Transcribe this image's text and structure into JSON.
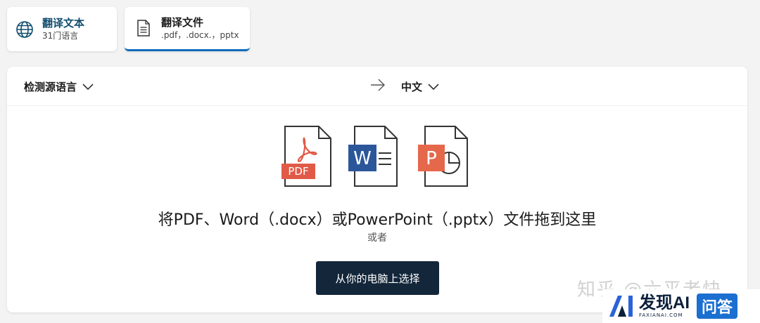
{
  "tabs": [
    {
      "title": "翻译文本",
      "subtitle": "31门语言",
      "icon": "globe-icon"
    },
    {
      "title": "翻译文件",
      "subtitle": ".pdf，.docx.，pptx",
      "icon": "document-icon",
      "selected": true
    }
  ],
  "language_bar": {
    "source": "检测源语言",
    "target": "中文"
  },
  "file_types": [
    {
      "label": "PDF",
      "color": "#e05a47"
    },
    {
      "label": "W",
      "color": "#2b579a"
    },
    {
      "label": "P",
      "color": "#e5684b"
    }
  ],
  "drop_zone": {
    "title": "将PDF、Word（.docx）或PowerPoint（.pptx）文件拖到这里",
    "or": "或者",
    "button": "从你的电脑上选择"
  },
  "watermark": "知乎 @六平老快",
  "brand": {
    "name": "发现AI",
    "domain": "FAXIANAI.COM",
    "badge": "问答"
  },
  "colors": {
    "accent": "#0f6cbd",
    "button_bg": "#13263a"
  }
}
